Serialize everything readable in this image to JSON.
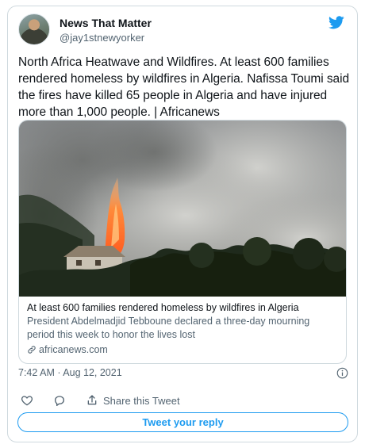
{
  "author": {
    "name": "News That Matter",
    "handle": "@jay1stnewyorker"
  },
  "tweet": {
    "text": "North Africa Heatwave and Wildfires. At least 600 families rendered homeless by wildfires in Algeria. Nafissa Toumi said the fires have killed 65 people in Algeria and have injured more than 1,000 people. | Africanews"
  },
  "link_card": {
    "title": "At least 600 families rendered homeless by wildfires in Algeria",
    "description": "President Abdelmadjid Tebboune declared a three-day mourning period this week to honor the lives lost",
    "domain": "africanews.com"
  },
  "meta": {
    "timestamp": "7:42 AM · Aug 12, 2021"
  },
  "actions": {
    "share_label": "Share this Tweet"
  },
  "reply_button": {
    "label": "Tweet your reply"
  },
  "icons": {
    "brand": "twitter-bird-icon",
    "info": "info-icon",
    "like": "heart-icon",
    "reply": "comment-icon",
    "share": "share-icon",
    "link": "link-icon"
  },
  "colors": {
    "accent": "#1d9bf0",
    "text": "#0f1419",
    "muted": "#536471",
    "border": "#cfd9de"
  }
}
